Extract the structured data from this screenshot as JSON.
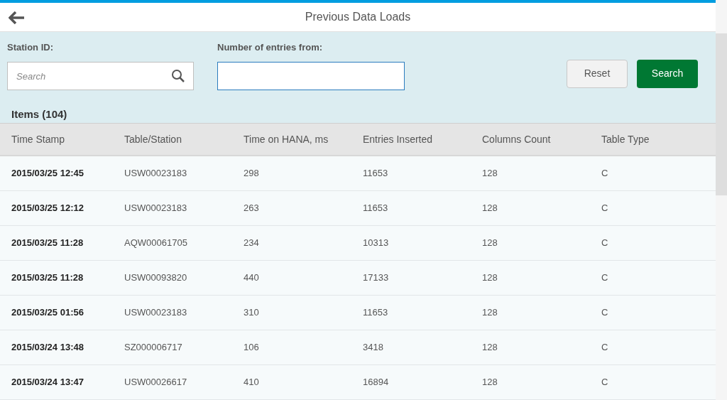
{
  "header": {
    "title": "Previous Data Loads"
  },
  "filters": {
    "station_label": "Station ID:",
    "station_placeholder": "Search",
    "entries_label": "Number of entries from:",
    "reset": "Reset",
    "search": "Search"
  },
  "items_title": "Items (104)",
  "table": {
    "columns": [
      "Time Stamp",
      "Table/Station",
      "Time on HANA, ms",
      "Entries Inserted",
      "Columns Count",
      "Table Type"
    ],
    "rows": [
      [
        "2015/03/25 12:45",
        "USW00023183",
        "298",
        "11653",
        "128",
        "C"
      ],
      [
        "2015/03/25 12:12",
        "USW00023183",
        "263",
        "11653",
        "128",
        "C"
      ],
      [
        "2015/03/25 11:28",
        "AQW00061705",
        "234",
        "10313",
        "128",
        "C"
      ],
      [
        "2015/03/25 11:28",
        "USW00093820",
        "440",
        "17133",
        "128",
        "C"
      ],
      [
        "2015/03/25 01:56",
        "USW00023183",
        "310",
        "11653",
        "128",
        "C"
      ],
      [
        "2015/03/24 13:48",
        "SZ000006717",
        "106",
        "3418",
        "128",
        "C"
      ],
      [
        "2015/03/24 13:47",
        "USW00026617",
        "410",
        "16894",
        "128",
        "C"
      ]
    ]
  }
}
